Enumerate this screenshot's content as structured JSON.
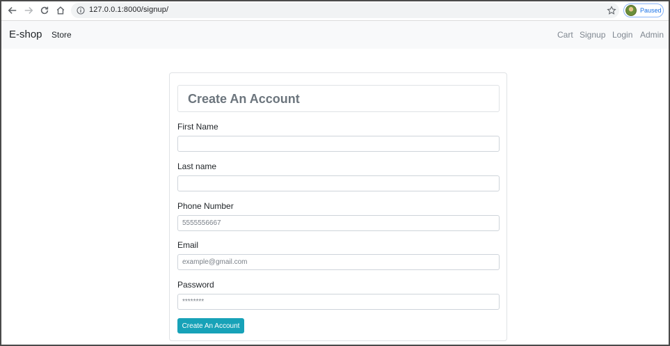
{
  "browser": {
    "url": "127.0.0.1:8000/signup/",
    "profile_status": "Paused"
  },
  "navbar": {
    "brand": "E-shop",
    "left_links": [
      "Store"
    ],
    "right_links": [
      "Cart",
      "Signup",
      "Login",
      "Admin"
    ]
  },
  "form": {
    "title": "Create An Account",
    "fields": [
      {
        "label": "First Name",
        "placeholder": "",
        "value": ""
      },
      {
        "label": "Last name",
        "placeholder": "",
        "value": ""
      },
      {
        "label": "Phone Number",
        "placeholder": "5555556667",
        "value": ""
      },
      {
        "label": "Email",
        "placeholder": "example@gmail.com",
        "value": ""
      },
      {
        "label": "Password",
        "placeholder": "********",
        "value": ""
      }
    ],
    "submit_label": "Create An Account"
  },
  "colors": {
    "submit_button": "#17a2b8",
    "navbar_bg": "#f8f9fa",
    "title_text": "#6c757d"
  }
}
